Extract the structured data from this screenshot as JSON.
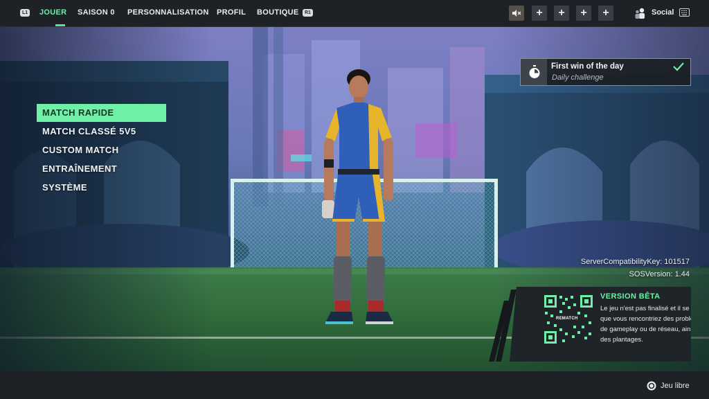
{
  "topbar": {
    "left_hint": "L1",
    "right_hint": "R1",
    "tabs": [
      {
        "label": "JOUER",
        "active": true
      },
      {
        "label": "SAISON 0",
        "active": false
      },
      {
        "label": "PERSONNALISATION",
        "active": false
      },
      {
        "label": "PROFIL",
        "active": false
      },
      {
        "label": "BOUTIQUE",
        "active": false
      }
    ],
    "party_slots": [
      "+",
      "+",
      "+",
      "+"
    ],
    "social_label": "Social",
    "accent_color": "#6af0a6"
  },
  "menu": {
    "items": [
      {
        "label": "MATCH RAPIDE",
        "selected": true
      },
      {
        "label": "MATCH CLASSÉ 5V5",
        "selected": false
      },
      {
        "label": "CUSTOM MATCH",
        "selected": false
      },
      {
        "label": "ENTRAÎNEMENT",
        "selected": false
      },
      {
        "label": "SYSTÈME",
        "selected": false
      }
    ]
  },
  "challenge": {
    "title": "First win of the day",
    "subtitle": "Daily challenge",
    "completed": true,
    "icon": "stopwatch-icon"
  },
  "version": {
    "server_key": "ServerCompatibilityKey: 101517",
    "sos_version": "SOSVersion: 1.44"
  },
  "beta": {
    "title": "VERSION BÊTA",
    "text": "Le jeu n'est pas finalisé et il se peut que vous rencontriez des problèmes de gameplay ou de réseau, ainsi que des plantages.",
    "qr_label": "REMATCH"
  },
  "bottombar": {
    "free_label": "Jeu libre",
    "button_icon": "circle-button-icon"
  }
}
